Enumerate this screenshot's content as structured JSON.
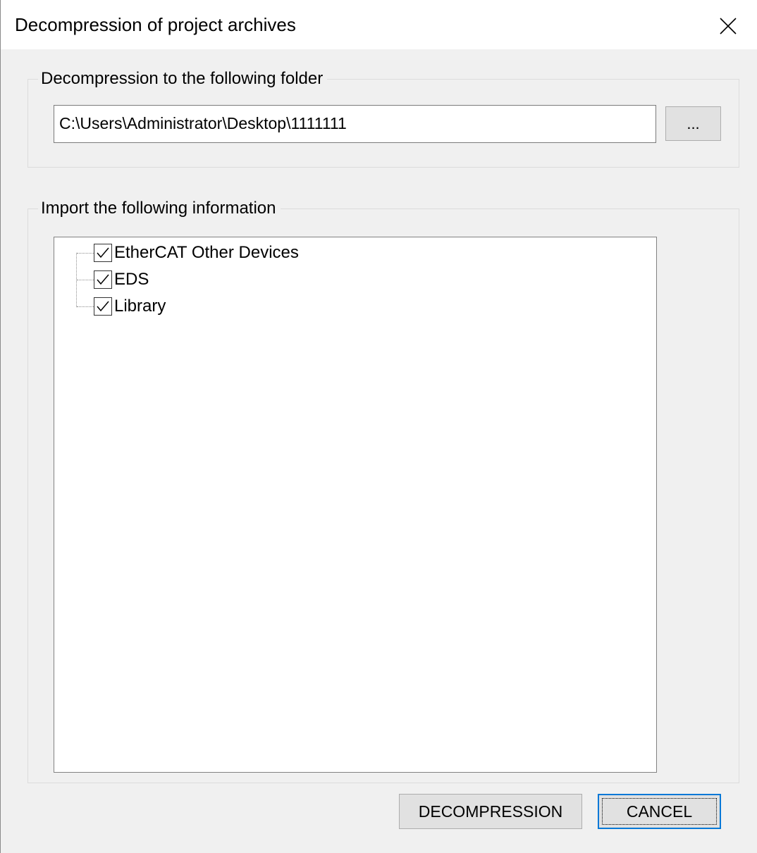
{
  "dialog": {
    "title": "Decompression of project archives",
    "close_icon": "close-x-icon"
  },
  "destination": {
    "group_label": "Decompression to the following folder",
    "path_value": "C:\\Users\\Administrator\\Desktop\\1111111",
    "browse_label": "..."
  },
  "import": {
    "group_label": "Import the following information",
    "items": [
      {
        "label": "EtherCAT Other Devices",
        "checked": true
      },
      {
        "label": "EDS",
        "checked": true
      },
      {
        "label": "Library",
        "checked": true
      }
    ]
  },
  "buttons": {
    "decompression_label": "DECOMPRESSION",
    "cancel_label": "CANCEL"
  },
  "colors": {
    "dialog_background": "#f0f0f0",
    "title_background": "#ffffff",
    "default_button_border": "#0078d7"
  }
}
